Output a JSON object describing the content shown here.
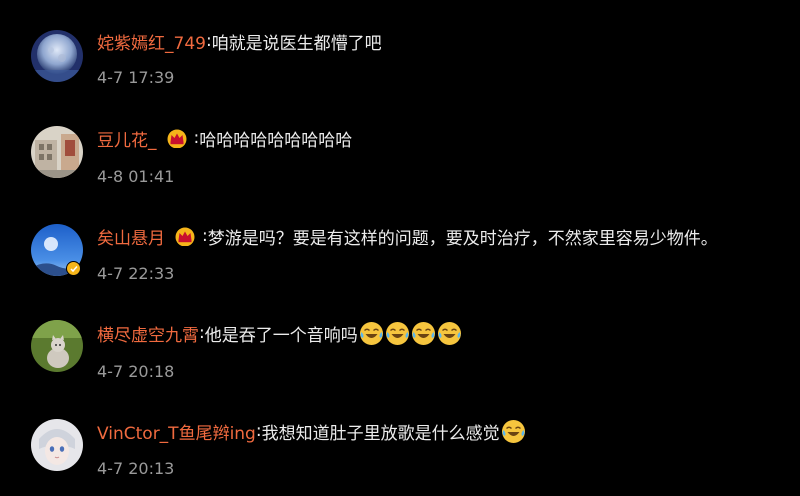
{
  "comments": [
    {
      "username": "姹紫嫣红_749",
      "separator": ":",
      "text": "咱就是说医生都懵了吧",
      "time": "4-7 17:39",
      "has_crown": false,
      "verified": false,
      "emoji_count": 0,
      "avatar_icon": "moon-avatar"
    },
    {
      "username": "豆儿花_",
      "separator": ":",
      "text": "哈哈哈哈哈哈哈哈哈",
      "time": "4-8 01:41",
      "has_crown": true,
      "verified": false,
      "emoji_count": 0,
      "avatar_icon": "building-avatar"
    },
    {
      "username": "矣山悬月",
      "separator": ":",
      "text": "梦游是吗？要是有这样的问题，要及时治疗，不然家里容易少物件。",
      "time": "4-7 22:33",
      "has_crown": true,
      "verified": true,
      "emoji_count": 0,
      "avatar_icon": "blue-sky-avatar"
    },
    {
      "username": "横尽虚空九霄",
      "separator": ":",
      "text": "他是吞了一个音响吗",
      "time": "4-7 20:18",
      "has_crown": false,
      "verified": false,
      "emoji_count": 4,
      "avatar_icon": "cat-avatar"
    },
    {
      "username": "VinCtor_T鱼尾辫ing",
      "separator": ":",
      "text": "我想知道肚子里放歌是什么感觉",
      "time": "4-7 20:13",
      "has_crown": false,
      "verified": false,
      "emoji_count": 1,
      "avatar_icon": "anime-avatar"
    }
  ],
  "colors": {
    "background": "#000000",
    "username": "#f06a3f",
    "text": "#ececec",
    "time": "#9a9a9a",
    "crown": "#f5b51a"
  },
  "icons": {
    "crown": "crown-icon",
    "verified": "verified-badge-icon",
    "emoji": "laugh-cry-emoji-icon"
  }
}
